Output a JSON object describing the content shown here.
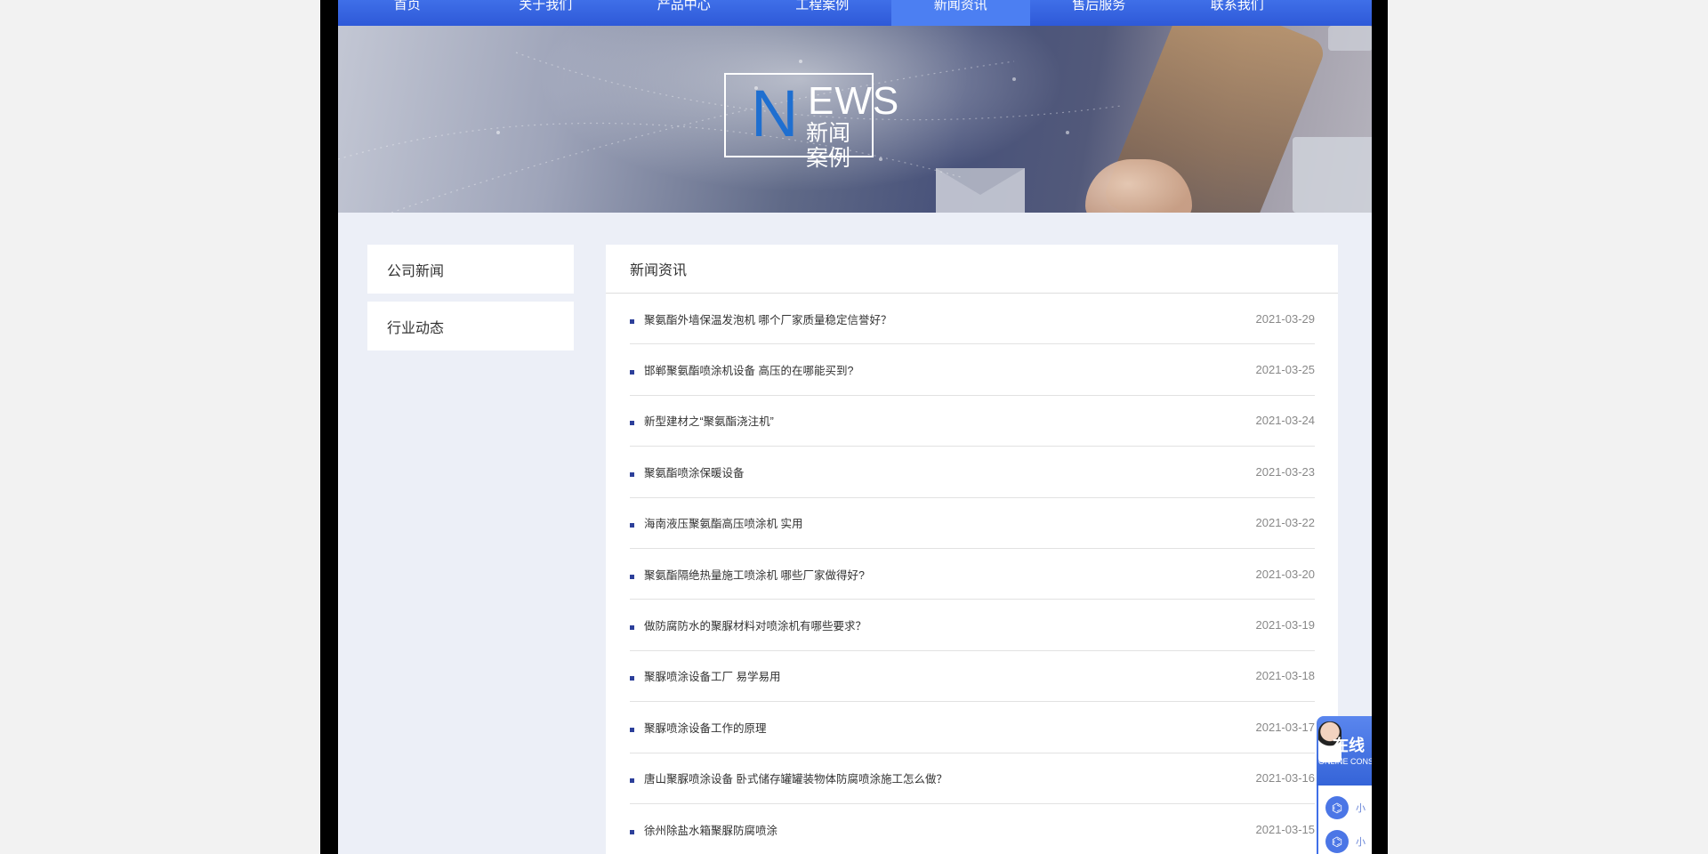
{
  "nav": {
    "items": [
      {
        "label": "首页"
      },
      {
        "label": "关于我们"
      },
      {
        "label": "产品中心"
      },
      {
        "label": "工程案例"
      },
      {
        "label": "新闻资讯"
      },
      {
        "label": "售后服务"
      },
      {
        "label": "联系我们"
      }
    ],
    "active_label": "新闻资讯"
  },
  "banner": {
    "logo_letter": "N",
    "logo_rest": "EWS",
    "logo_cn": "新闻案例"
  },
  "sidebar": {
    "items": [
      {
        "label": "公司新闻"
      },
      {
        "label": "行业动态"
      }
    ]
  },
  "panel": {
    "title": "新闻资讯",
    "news": [
      {
        "title": "聚氨酯外墙保温发泡机 哪个厂家质量稳定信誉好？",
        "date": "2021-03-29"
      },
      {
        "title": "邯郸聚氨酯喷涂机设备 高压的在哪能买到?",
        "date": "2021-03-25"
      },
      {
        "title": "新型建材之“聚氨酯浇注机”",
        "date": "2021-03-24"
      },
      {
        "title": "聚氨酯喷涂保暖设备",
        "date": "2021-03-23"
      },
      {
        "title": "海南液压聚氨酯高压喷涂机 实用",
        "date": "2021-03-22"
      },
      {
        "title": "聚氨酯隔绝热量施工喷涂机 哪些厂家做得好?",
        "date": "2021-03-20"
      },
      {
        "title": "做防腐防水的聚脲材料对喷涂机有哪些要求？",
        "date": "2021-03-19"
      },
      {
        "title": "聚脲喷涂设备工厂 易学易用",
        "date": "2021-03-18"
      },
      {
        "title": "聚脲喷涂设备工作的原理",
        "date": "2021-03-17"
      },
      {
        "title": "唐山聚脲喷涂设备 卧式储存罐罐装物体防腐喷涂施工怎么做？",
        "date": "2021-03-16"
      },
      {
        "title": "徐州除盐水箱聚脲防腐喷涂",
        "date": "2021-03-15"
      }
    ]
  },
  "consult": {
    "title_cn": "在线",
    "title_en": "ONLINE CONSU",
    "agents": [
      {
        "name": "小"
      },
      {
        "name": "小"
      }
    ]
  },
  "colors": {
    "nav": "#3f6fe8",
    "bullet": "#2c3f9a",
    "page_bg": "#eceff7"
  }
}
